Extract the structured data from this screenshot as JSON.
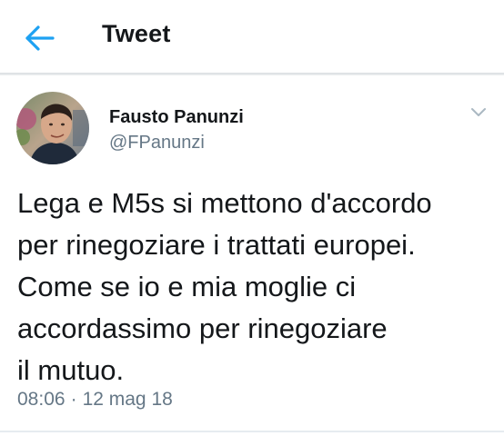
{
  "header": {
    "title": "Tweet",
    "back_icon": "arrow-left-icon",
    "accent_color": "#1da1f2"
  },
  "tweet": {
    "author": {
      "name": "Fausto Panunzi",
      "handle": "@FPanunzi",
      "avatar": "profile-photo"
    },
    "menu_icon": "chevron-down-icon",
    "text_lines": [
      "Lega e M5s si mettono d'accordo",
      "per rinegoziare i trattati europei.",
      "Come se io e mia moglie ci",
      "accordassimo per rinegoziare",
      "il mutuo."
    ],
    "time": "08:06",
    "separator": "·",
    "date": "12 mag 18"
  }
}
